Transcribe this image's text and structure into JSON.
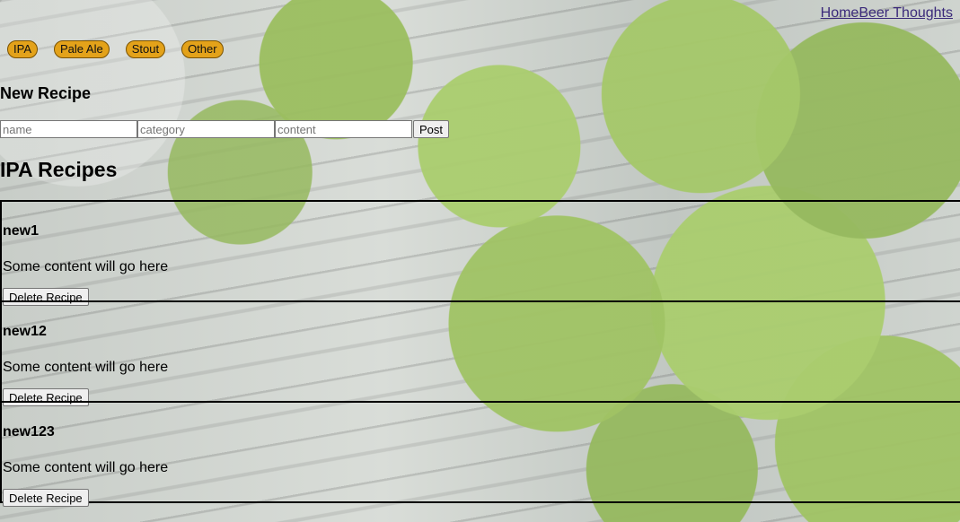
{
  "nav": {
    "home_label": "Home",
    "beer_thoughts_label": "Beer Thoughts"
  },
  "categories": [
    {
      "label": "IPA"
    },
    {
      "label": "Pale Ale"
    },
    {
      "label": "Stout"
    },
    {
      "label": "Other"
    }
  ],
  "colors": {
    "pill_background": "#e3a21a"
  },
  "new_recipe": {
    "title": "New Recipe",
    "name_placeholder": "name",
    "category_placeholder": "category",
    "content_placeholder": "content",
    "post_label": "Post"
  },
  "section": {
    "title": "IPA Recipes"
  },
  "recipes": [
    {
      "name": "new1",
      "content": "Some content will go here",
      "delete_label": "Delete Recipe"
    },
    {
      "name": "new12",
      "content": "Some content will go here",
      "delete_label": "Delete Recipe"
    },
    {
      "name": "new123",
      "content": "Some content will go here",
      "delete_label": "Delete Recipe"
    }
  ]
}
